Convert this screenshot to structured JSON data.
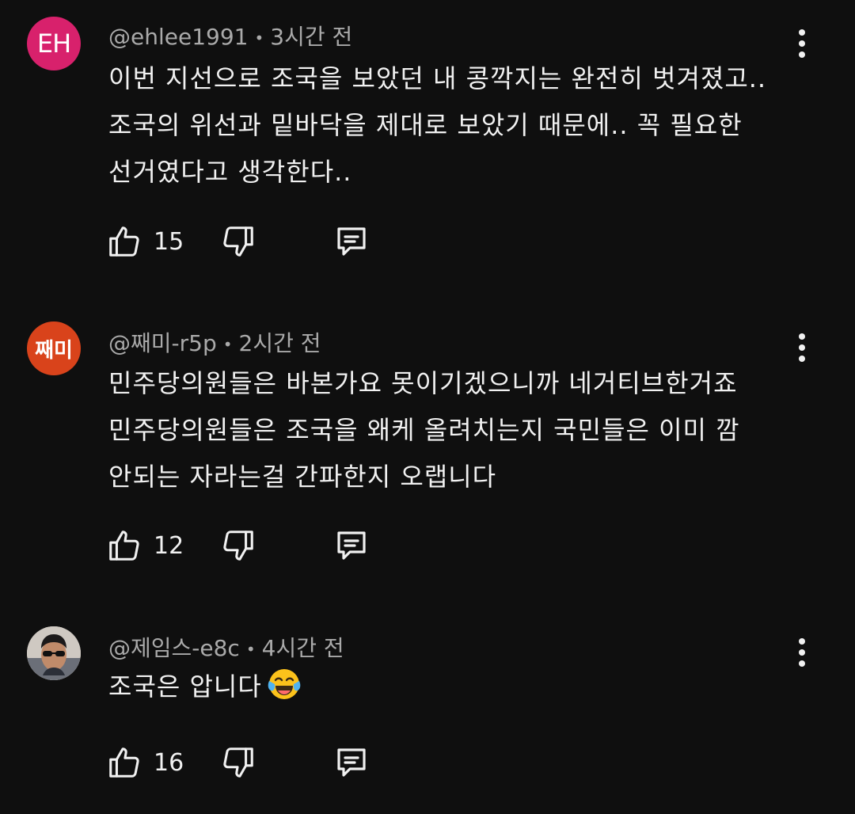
{
  "comments": [
    {
      "avatar_text": "EH",
      "author": "@ehlee1991",
      "time": "3시간 전",
      "lines": [
        "이번 지선으로 조국을 보았던 내 콩깍지는 완전히 벗겨졌고..",
        "조국의 위선과 밑바닥을 제대로 보았기 때문에.. 꼭 필요한",
        "선거였다고 생각한다.."
      ],
      "likes": "15"
    },
    {
      "avatar_text": "째미",
      "author": "@째미-r5p",
      "time": "2시간 전",
      "lines": [
        "민주당의원들은 바본가요 못이기겠으니까 네거티브한거죠",
        "민주당의원들은 조국을 왜케 올려치는지 국민들은 이미 깜",
        "안되는 자라는걸 간파한지 오랩니다"
      ],
      "likes": "12"
    },
    {
      "avatar_text": "",
      "author": "@제임스-e8c",
      "time": "4시간 전",
      "lines": [
        "조국은 압니다"
      ],
      "emoji": "face-with-tears-of-joy",
      "likes": "16"
    }
  ],
  "icons": {
    "like": "thumbs-up-icon",
    "dislike": "thumbs-down-icon",
    "reply": "reply-icon",
    "more": "more-vert-icon"
  },
  "colors": {
    "background": "#0f0f0f",
    "text": "#f1f1f1",
    "meta": "#aaaaaa",
    "avatar_eh": "#d8216c",
    "avatar_jm": "#d9431b"
  }
}
